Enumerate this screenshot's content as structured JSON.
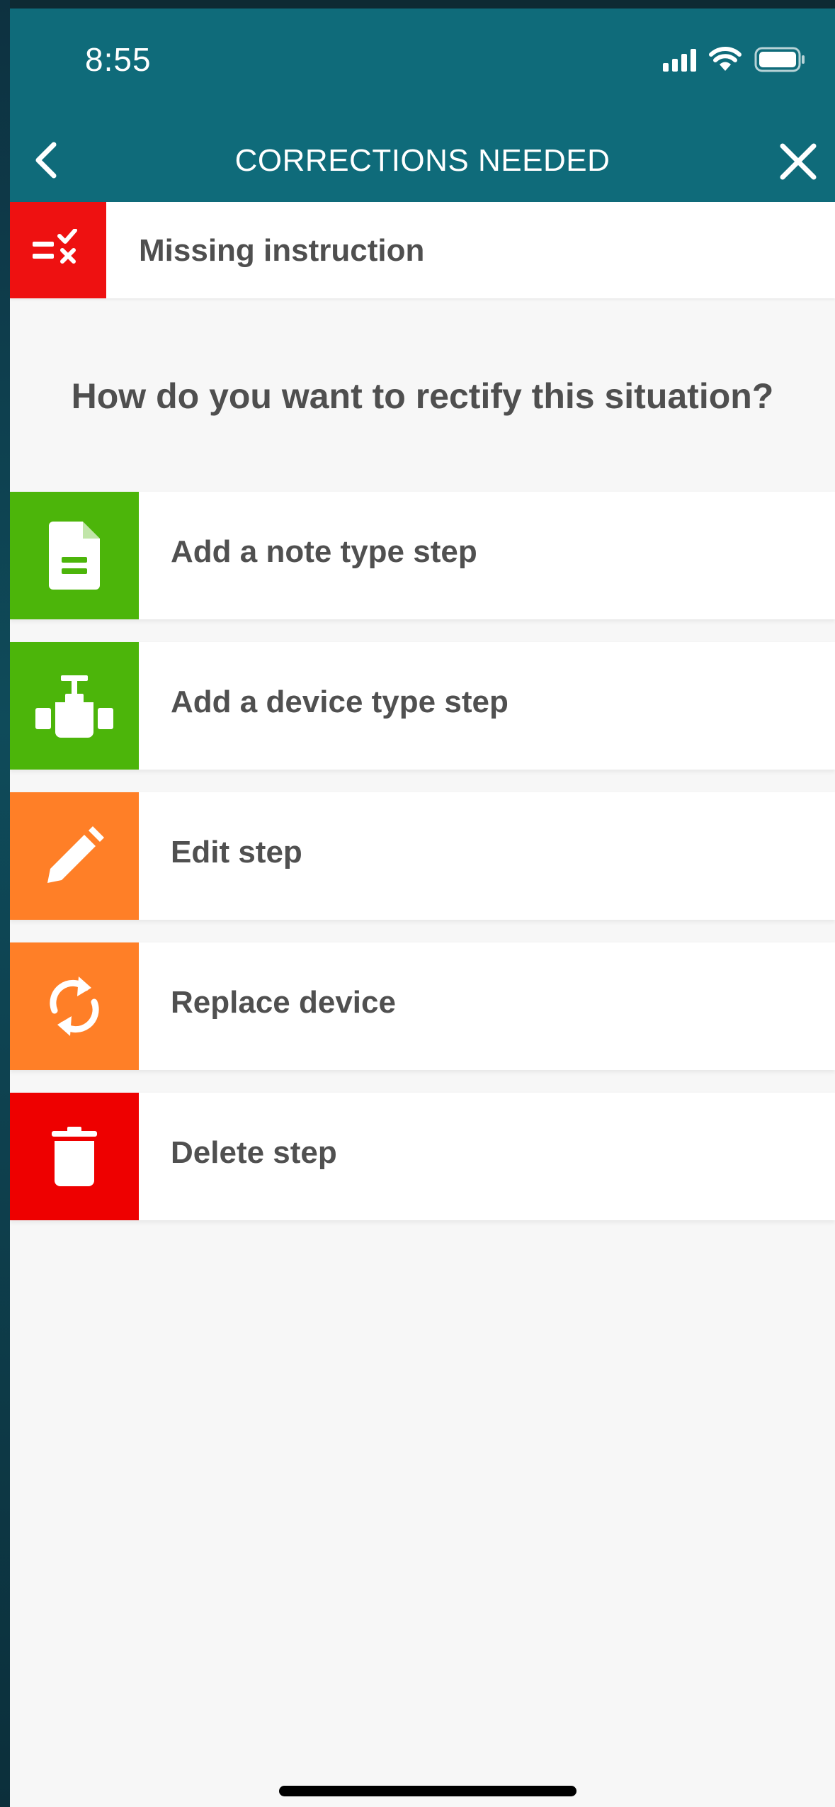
{
  "status_bar": {
    "time": "8:55"
  },
  "nav": {
    "title": "CORRECTIONS NEEDED"
  },
  "issue": {
    "label": "Missing instruction",
    "color": "#ee1111"
  },
  "question": "How do you want to rectify this situation?",
  "options": [
    {
      "label": "Add a note type step",
      "icon": "note-icon",
      "color": "#4cb50a"
    },
    {
      "label": "Add a device type step",
      "icon": "valve-icon",
      "color": "#4cb50a"
    },
    {
      "label": "Edit step",
      "icon": "pencil-icon",
      "color": "#ff7f27"
    },
    {
      "label": "Replace device",
      "icon": "refresh-icon",
      "color": "#ff7f27"
    },
    {
      "label": "Delete step",
      "icon": "trash-icon",
      "color": "#ee0000"
    }
  ]
}
